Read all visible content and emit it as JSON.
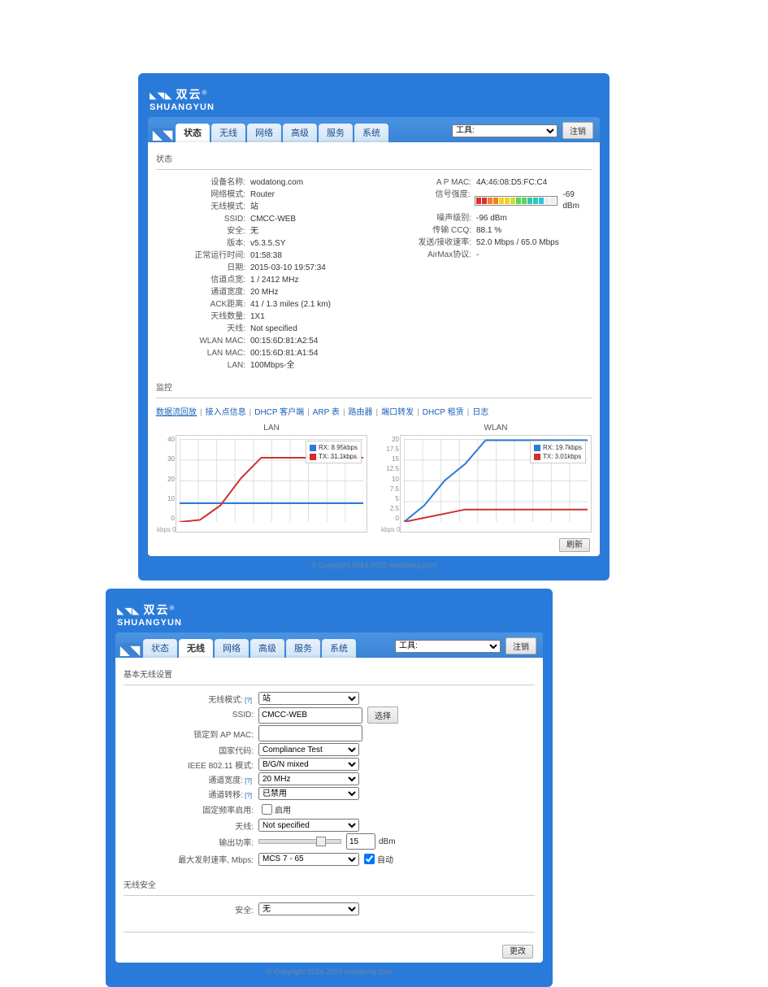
{
  "brand_cn": "双云",
  "brand_en": "SHUANGYUN",
  "tabs": [
    "状态",
    "无线",
    "网络",
    "高级",
    "服务",
    "系统"
  ],
  "tool_select": "工具:",
  "logout_btn": "注销",
  "copyright": "© Copyright 2014-2015 wodatong.com",
  "screen1": {
    "active_tab": "状态",
    "sec_status": "状态",
    "sec_monitor": "监控",
    "left": [
      {
        "l": "设备名称:",
        "v": "wodatong.com"
      },
      {
        "l": "网络模式:",
        "v": "Router"
      },
      {
        "l": "无线模式:",
        "v": "站"
      },
      {
        "l": "SSID:",
        "v": "CMCC-WEB"
      },
      {
        "l": "安全:",
        "v": "无"
      },
      {
        "l": "版本:",
        "v": "v5.3.5.SY"
      },
      {
        "l": "正常运行时间:",
        "v": "01:58:38"
      },
      {
        "l": "日期:",
        "v": "2015-03-10 19:57:34"
      },
      {
        "l": "信道点宽:",
        "v": "1 / 2412 MHz"
      },
      {
        "l": "通道宽度:",
        "v": "20 MHz"
      },
      {
        "l": "ACK距离:",
        "v": "41 / 1.3 miles (2.1 km)"
      },
      {
        "l": "天线数量:",
        "v": "1X1"
      },
      {
        "l": "天线:",
        "v": "Not specified"
      },
      {
        "l": "WLAN MAC:",
        "v": "00:15:6D:81:A2:54"
      },
      {
        "l": "LAN MAC:",
        "v": "00:15:6D:81:A1:54"
      },
      {
        "l": "LAN:",
        "v": "100Mbps-全"
      }
    ],
    "right": [
      {
        "l": "A P MAC:",
        "v": "4A:46:08:D5:FC:C4"
      },
      {
        "l": "信号强度:",
        "v": ""
      },
      {
        "l": "噪声级别:",
        "v": "-96 dBm"
      },
      {
        "l": "传输 CCQ:",
        "v": "88.1 %"
      },
      {
        "l": "发送/接收速率:",
        "v": "52.0 Mbps / 65.0 Mbps"
      },
      {
        "l": "AirMax协议:",
        "v": "-"
      }
    ],
    "signal_readout": "-69 dBm",
    "links": [
      "数据流回放",
      "接入点信息",
      "DHCP 客户端",
      "ARP 表",
      "路由器",
      "端口转发",
      "DHCP 租赁",
      "日志"
    ],
    "chart_lan_title": "LAN",
    "chart_wlan_title": "WLAN",
    "lan_rx_lbl": "RX: 8.95kbps",
    "lan_tx_lbl": "TX: 31.1kbps",
    "wlan_rx_lbl": "RX: 19.7kbps",
    "wlan_tx_lbl": "TX: 3.01kbps",
    "refresh_btn": "刷新",
    "kbps": "kbps 0"
  },
  "screen2": {
    "active_tab": "无线",
    "sec_basic": "基本无线设置",
    "sec_security": "无线安全",
    "fields": {
      "mode_lbl": "无线模式:",
      "mode_val": "站",
      "ssid_lbl": "SSID:",
      "ssid_val": "CMCC-WEB",
      "ssid_btn": "选择",
      "lockap_lbl": "锁定到 AP MAC:",
      "country_lbl": "国家代码:",
      "country_val": "Compliance Test",
      "ieee_lbl": "IEEE 802.11 模式:",
      "ieee_val": "B/G/N mixed",
      "chwidth_lbl": "通道宽度:",
      "chwidth_val": "20 MHz",
      "chshift_lbl": "通道转移:",
      "chshift_val": "已禁用",
      "fix_lbl": "固定频率启用:",
      "fix_enable": "启用",
      "ant_lbl": "天线:",
      "ant_val": "Not specified",
      "pwr_lbl": "输出功率:",
      "pwr_val": "15",
      "pwr_unit": "dBm",
      "rate_lbl": "最大发射速率, Mbps:",
      "rate_val": "MCS 7 - 65",
      "auto": "自动",
      "sec_lbl": "安全:",
      "sec_val": "无",
      "save_btn": "更改"
    }
  },
  "chart_data": [
    {
      "id": "lan",
      "type": "line",
      "title": "LAN",
      "ylabel": "kbps",
      "ylim": [
        0,
        40
      ],
      "yticks": [
        0,
        10,
        20,
        30,
        40
      ],
      "x": [
        0,
        1,
        2,
        3,
        4,
        5,
        6,
        7,
        8,
        9
      ],
      "series": [
        {
          "name": "RX",
          "color": "#2a7bd9",
          "values": [
            9,
            9,
            9,
            9,
            9,
            9,
            9,
            9,
            9,
            9
          ]
        },
        {
          "name": "TX",
          "color": "#d03030",
          "values": [
            0,
            1,
            8,
            21,
            31,
            31,
            31,
            31,
            31,
            31
          ]
        }
      ],
      "legend": [
        "RX: 8.95kbps",
        "TX: 31.1kbps"
      ]
    },
    {
      "id": "wlan",
      "type": "line",
      "title": "WLAN",
      "ylabel": "kbps",
      "ylim": [
        0,
        20
      ],
      "yticks": [
        0,
        2.5,
        5,
        7.5,
        10,
        12.5,
        15,
        17.5,
        20
      ],
      "x": [
        0,
        1,
        2,
        3,
        4,
        5,
        6,
        7,
        8,
        9
      ],
      "series": [
        {
          "name": "RX",
          "color": "#2a7bd9",
          "values": [
            0,
            4,
            10,
            14,
            19.7,
            19.7,
            19.7,
            19.7,
            19.7,
            19.7
          ]
        },
        {
          "name": "TX",
          "color": "#d03030",
          "values": [
            0,
            1,
            2,
            3,
            3,
            3,
            3,
            3,
            3,
            3
          ]
        }
      ],
      "legend": [
        "RX: 19.7kbps",
        "TX: 3.01kbps"
      ]
    }
  ]
}
